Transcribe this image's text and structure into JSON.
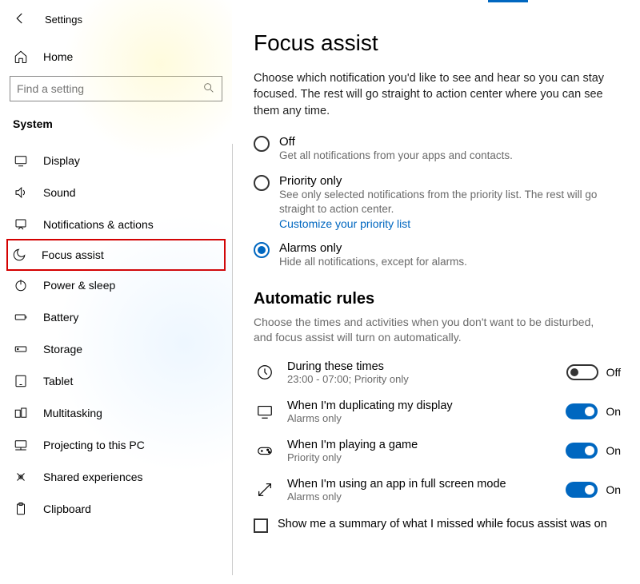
{
  "app_title": "Settings",
  "sidebar": {
    "home": "Home",
    "search_placeholder": "Find a setting",
    "category": "System",
    "items": [
      {
        "icon": "display-icon",
        "label": "Display"
      },
      {
        "icon": "sound-icon",
        "label": "Sound"
      },
      {
        "icon": "notifications-icon",
        "label": "Notifications & actions"
      },
      {
        "icon": "focus-assist-icon",
        "label": "Focus assist"
      },
      {
        "icon": "power-icon",
        "label": "Power & sleep"
      },
      {
        "icon": "battery-icon",
        "label": "Battery"
      },
      {
        "icon": "storage-icon",
        "label": "Storage"
      },
      {
        "icon": "tablet-icon",
        "label": "Tablet"
      },
      {
        "icon": "multitasking-icon",
        "label": "Multitasking"
      },
      {
        "icon": "projecting-icon",
        "label": "Projecting to this PC"
      },
      {
        "icon": "shared-icon",
        "label": "Shared experiences"
      },
      {
        "icon": "clipboard-icon",
        "label": "Clipboard"
      }
    ],
    "highlighted_index": 3
  },
  "main": {
    "title": "Focus assist",
    "description": "Choose which notification you'd like to see and hear so you can stay focused. The rest will go straight to action center where you can see them any time.",
    "radio_options": [
      {
        "label": "Off",
        "sub": "Get all notifications from your apps and contacts.",
        "selected": false
      },
      {
        "label": "Priority only",
        "sub": "See only selected notifications from the priority list. The rest will go straight to action center.",
        "link": "Customize your priority list",
        "selected": false
      },
      {
        "label": "Alarms only",
        "sub": "Hide all notifications, except for alarms.",
        "selected": true
      }
    ],
    "auto_rules_title": "Automatic rules",
    "auto_rules_desc": "Choose the times and activities when you don't want to be disturbed, and focus assist will turn on automatically.",
    "rules": [
      {
        "icon": "clock-icon",
        "label": "During these times",
        "sub": "23:00 - 07:00; Priority only",
        "state": "Off",
        "on": false
      },
      {
        "icon": "monitor-icon",
        "label": "When I'm duplicating my display",
        "sub": "Alarms only",
        "state": "On",
        "on": true
      },
      {
        "icon": "game-icon",
        "label": "When I'm playing a game",
        "sub": "Priority only",
        "state": "On",
        "on": true
      },
      {
        "icon": "fullscreen-icon",
        "label": "When I'm using an app in full screen mode",
        "sub": "Alarms only",
        "state": "On",
        "on": true
      }
    ],
    "summary_checkbox": "Show me a summary of what I missed while focus assist was on"
  }
}
